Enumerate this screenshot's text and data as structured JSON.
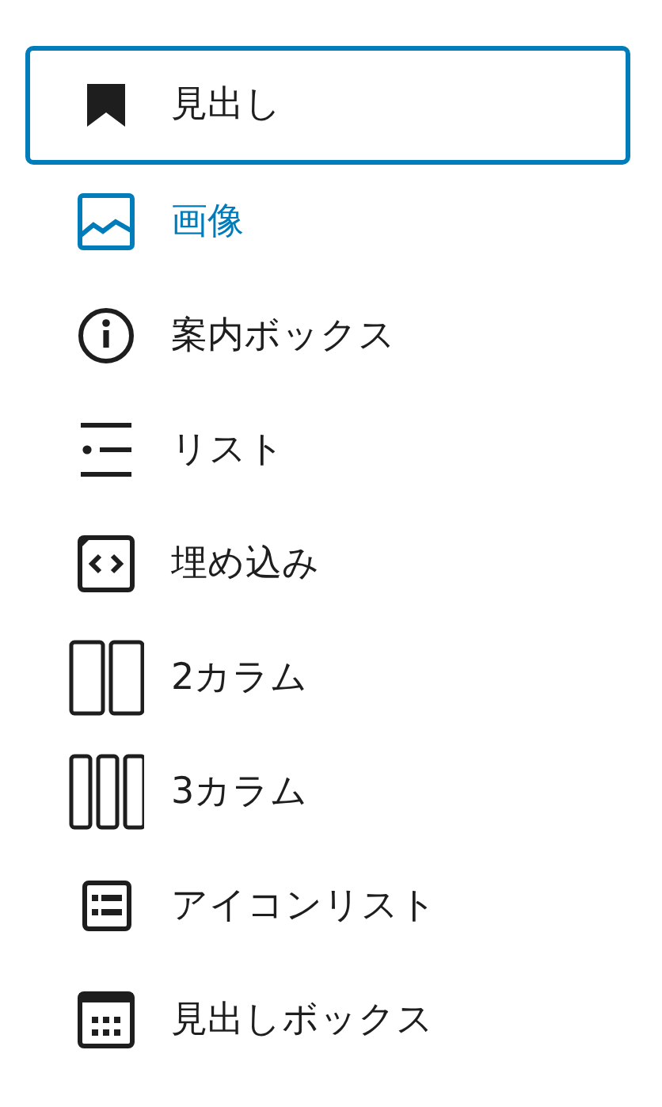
{
  "blocks": [
    {
      "kind": "heading",
      "label": "見出し",
      "selected": true,
      "hovered": false
    },
    {
      "kind": "image",
      "label": "画像",
      "selected": false,
      "hovered": true
    },
    {
      "kind": "info",
      "label": "案内ボックス",
      "selected": false,
      "hovered": false
    },
    {
      "kind": "list",
      "label": "リスト",
      "selected": false,
      "hovered": false
    },
    {
      "kind": "embed",
      "label": "埋め込み",
      "selected": false,
      "hovered": false
    },
    {
      "kind": "columns2",
      "label": "2カラム",
      "selected": false,
      "hovered": false
    },
    {
      "kind": "columns3",
      "label": "3カラム",
      "selected": false,
      "hovered": false
    },
    {
      "kind": "iconlist",
      "label": "アイコンリスト",
      "selected": false,
      "hovered": false
    },
    {
      "kind": "headingbox",
      "label": "見出しボックス",
      "selected": false,
      "hovered": false
    }
  ]
}
